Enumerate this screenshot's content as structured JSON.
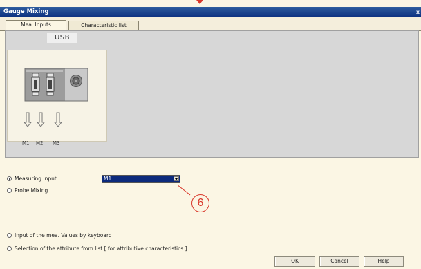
{
  "window": {
    "title": "Gauge Mixing",
    "close_label": "x"
  },
  "tabs": [
    {
      "label": "Mea. Inputs",
      "active": true
    },
    {
      "label": "Characteristic list",
      "active": false
    }
  ],
  "device": {
    "usb_label": "USB",
    "inputs": [
      "M1",
      "M2",
      "M3"
    ]
  },
  "options": {
    "measuring_input": "Measuring Input",
    "probe_mixing": "Probe Mixing",
    "keyboard_input": "Input of the mea. Values by keyboard",
    "attribute_selection": "Selection of the attribute from list [ for attributive characteristics ]",
    "selected": "measuring_input"
  },
  "input_select": {
    "value": "M1"
  },
  "annotation": {
    "label": "6",
    "color": "#d9372a"
  },
  "buttons": {
    "ok": "OK",
    "cancel": "Cancel",
    "help": "Help"
  },
  "colors": {
    "titlebar": "#0b2f80",
    "background": "#fbf6e4",
    "panel": "#d7d7d7",
    "selection": "#0c2a7c"
  }
}
